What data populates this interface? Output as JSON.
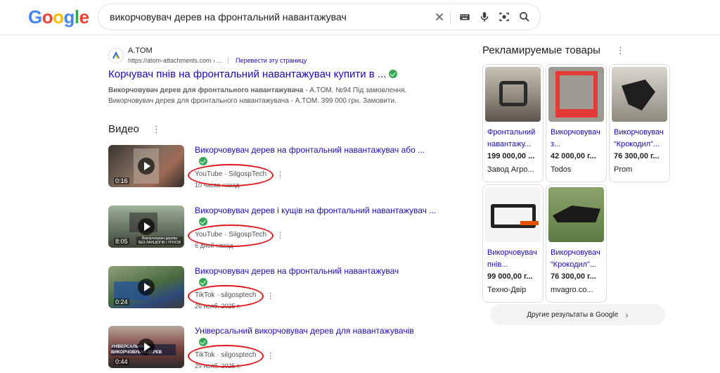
{
  "header": {
    "logo": [
      "G",
      "o",
      "o",
      "g",
      "l",
      "e"
    ],
    "logo_colors": [
      "#4285f4",
      "#ea4335",
      "#fbbc05",
      "#4285f4",
      "#34a853",
      "#ea4335"
    ],
    "query": "викорчовувач дерев на фронтальний навантажувач"
  },
  "top_result": {
    "site_name": "A.TOM",
    "url": "https://atom-attachments.com › ...",
    "translate": "Перевести эту страницу",
    "title": "Корчувач пнів на фронтальний навантажувач купити в ...",
    "snippet_bold": "Викорчовувач дерев для фронтального навантажувача",
    "snippet_1": " - A.TOM. №94 Під замовлення.",
    "snippet_2": "Викорчовувач дерев для фронтального навантажувача - A.TOM. 399 000 грн. Замовити."
  },
  "videos": {
    "heading": "Видео",
    "items": [
      {
        "title": "Викорчовувач дерев на фронтальний навантажувач або ...",
        "source": "YouTube · SilgospTech",
        "date": "10 часов назад",
        "duration": "0:16",
        "thumb_color": "#6b5e55"
      },
      {
        "title": "Викорчовувач дерев і кущів на фронтальний навантажувач ...",
        "source": "YouTube · SilgospTech",
        "date": "6 дней назад",
        "duration": "8:05",
        "thumb_color": "#6f7e6a",
        "thumb_caption": "Викорчовувач дерева\nБЕЗ ЛАНЦЮГІВ І ТРОСІВ"
      },
      {
        "title": "Викорчовувач дерев на фронтальний навантажувач",
        "source": "TikTok · silgosptech",
        "date": "26 нояб. 2025 г.",
        "duration": "0:24",
        "thumb_color": "#4a6b3f"
      },
      {
        "title": "Універсальний викорчовувач дерев для навантажувачів",
        "source": "TikTok · silgosptech",
        "date": "29 нояб. 2025 г.",
        "duration": "0:44",
        "thumb_color": "#7a3e3a",
        "thumb_caption": "УНІВЕРСАЛЬНИЙ\nВИКОРЧОВУВАЧ ДЕРЕВ"
      }
    ]
  },
  "ads": {
    "heading": "Рекламируемые товары",
    "cards": [
      {
        "title_1": "Фронтальний",
        "title_2": "навантажу...",
        "price": "199 000,00 ...",
        "seller": "Завод Агро..."
      },
      {
        "title_1": "Викорчовувач",
        "title_2": "з...",
        "price": "42 000,00 г...",
        "seller": "Todos"
      },
      {
        "title_1": "Викорчовувач",
        "title_2": "“Крокодил”...",
        "price": "76 300,00 г...",
        "seller": "Prom"
      },
      {
        "title_1": "Викорчовувач",
        "title_2": "пнів...",
        "price": "99 000,00 г...",
        "seller": "Техно-Двір"
      },
      {
        "title_1": "Викорчовувач",
        "title_2": "“Крокодил”...",
        "price": "76 300,00 г...",
        "seller": "mvagro.co..."
      }
    ],
    "more_button": "Другие результаты в Google"
  },
  "colors": {
    "link": "#1a0dab",
    "annotation": "#e0191e",
    "verified": "#34a853"
  }
}
